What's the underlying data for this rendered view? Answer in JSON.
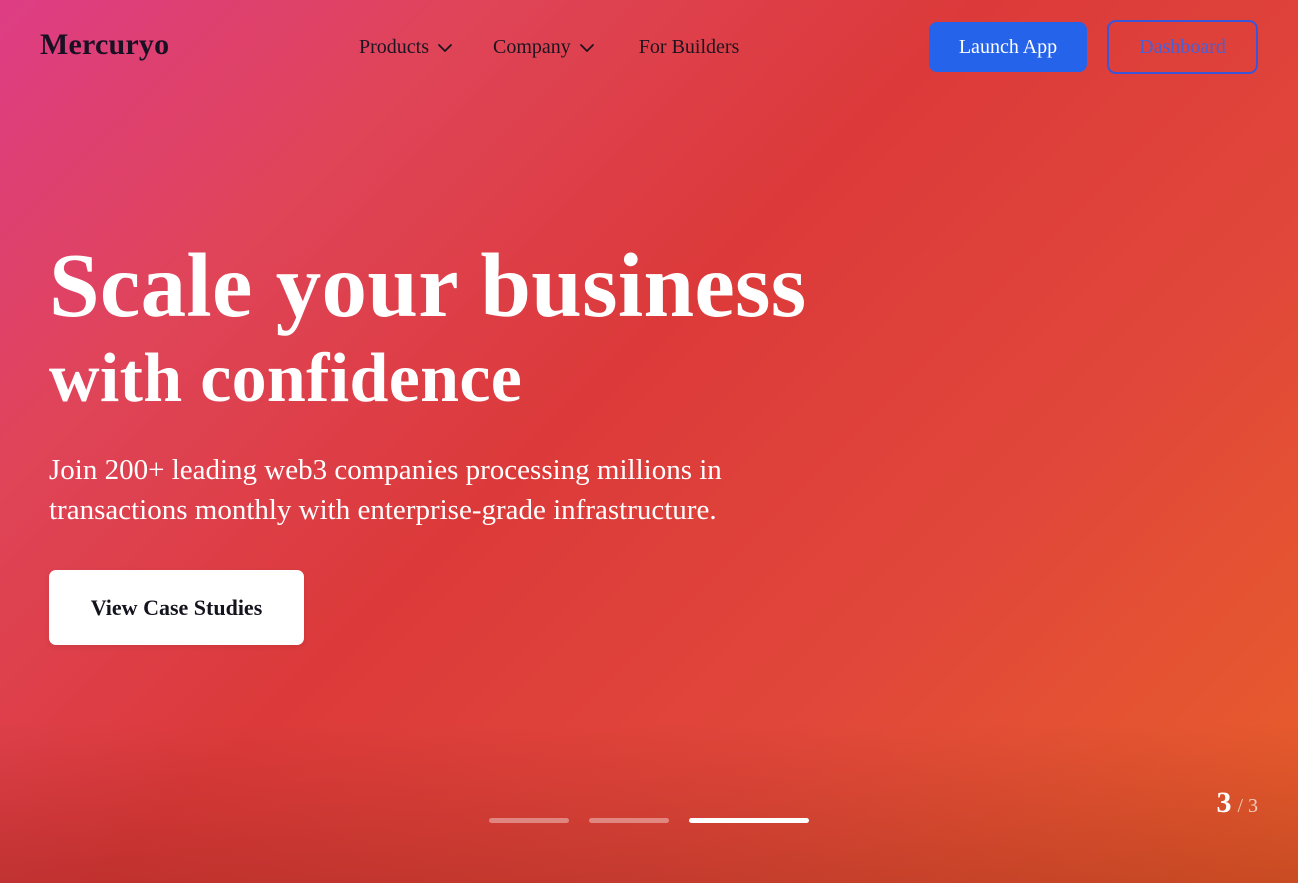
{
  "brand": {
    "logo_text": "Mercuryo"
  },
  "nav": {
    "items": [
      {
        "label": "Products",
        "has_dropdown": true,
        "icon": "chevron-down-icon"
      },
      {
        "label": "Company",
        "has_dropdown": true,
        "icon": "chevron-down-icon"
      },
      {
        "label": "For Builders",
        "has_dropdown": false
      }
    ],
    "launch_label": "Launch App",
    "dashboard_label": "Dashboard"
  },
  "hero": {
    "title_line1": "Scale your business",
    "title_line2": "with confidence",
    "subtitle": "Join 200+ leading web3 companies processing millions in transactions monthly with enterprise-grade infrastructure.",
    "cta_label": "View Case Studies"
  },
  "carousel": {
    "current": "3",
    "separator": "/",
    "total": "3",
    "active_index": 3,
    "slide_count": 3
  },
  "colors": {
    "primary_button": "#2563eb",
    "dashboard_border": "#3a56d8",
    "gradient_start": "#de3d85",
    "gradient_mid": "#dc3a3a",
    "gradient_end": "#e85f2a",
    "logo_text": "#1a1024"
  }
}
